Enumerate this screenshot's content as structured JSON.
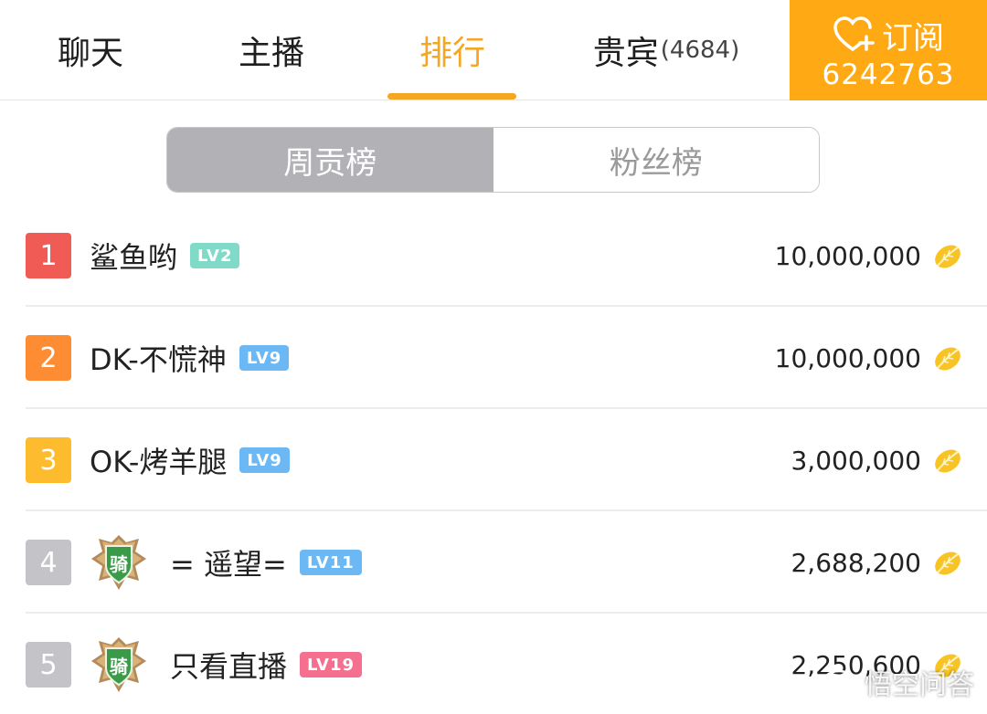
{
  "tabs": [
    {
      "label": "聊天"
    },
    {
      "label": "主播"
    },
    {
      "label": "排行"
    },
    {
      "label": "贵宾",
      "count": "(4684)"
    }
  ],
  "subscribe": {
    "label": "订阅",
    "count": "6242763",
    "icon": "heart-plus-icon",
    "bg_color": "#ffa914"
  },
  "segments": {
    "weekly": "周贡榜",
    "fans": "粉丝榜"
  },
  "accent_color": "#f5a623",
  "ranking": [
    {
      "rank": "1",
      "name": "鲨鱼哟",
      "level": "LV2",
      "level_color": "#7fdbc8",
      "score": "10,000,000",
      "badge": ""
    },
    {
      "rank": "2",
      "name": "DK-不慌神",
      "level": "LV9",
      "level_color": "#6cb8f4",
      "score": "10,000,000",
      "badge": ""
    },
    {
      "rank": "3",
      "name": "OK-烤羊腿",
      "level": "LV9",
      "level_color": "#6cb8f4",
      "score": "3,000,000",
      "badge": ""
    },
    {
      "rank": "4",
      "name": "= 遥望=",
      "level": "LV11",
      "level_color": "#6cb8f4",
      "score": "2,688,200",
      "badge": "骑"
    },
    {
      "rank": "5",
      "name": "只看直播",
      "level": "LV19",
      "level_color": "#f4708e",
      "score": "2,250,600",
      "badge": "骑"
    }
  ],
  "coin_icon": "gold-leaf-icon",
  "watermark": "悟空问答"
}
